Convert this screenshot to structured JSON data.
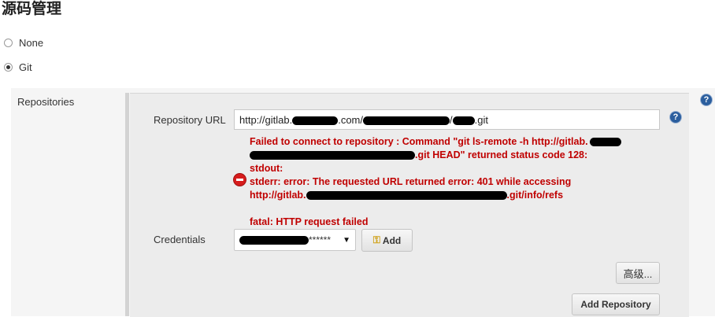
{
  "section": {
    "title": "源码管理"
  },
  "scm_options": [
    {
      "label": "None",
      "selected": false
    },
    {
      "label": "Git",
      "selected": true
    }
  ],
  "repositories": {
    "label": "Repositories",
    "url_label": "Repository URL",
    "url_value_parts": [
      "http://gitlab.",
      ".com/",
      "/",
      ".git"
    ],
    "error_lines": [
      [
        "Failed to connect to repository : Command \"git ls-remote -h http://gitlab.",
        ""
      ],
      [
        "",
        ".git HEAD\" returned status code 128:"
      ],
      [
        "stdout:",
        ""
      ],
      [
        "stderr: error: The requested URL returned error: 401 while accessing",
        ""
      ],
      [
        "http://gitlab.",
        ".git/info/refs"
      ],
      [
        "",
        ""
      ],
      [
        "fatal: HTTP request failed",
        ""
      ]
    ],
    "credentials_label": "Credentials",
    "credentials_value": "******",
    "add_label": "Add",
    "advanced_label": "高级...",
    "add_repository_label": "Add Repository"
  },
  "icons": {
    "help": "help-icon",
    "error": "error-icon",
    "key": "key-icon",
    "dropdown": "chevron-down-icon"
  },
  "colors": {
    "error": "#c00000",
    "help": "#2b5e9e"
  }
}
